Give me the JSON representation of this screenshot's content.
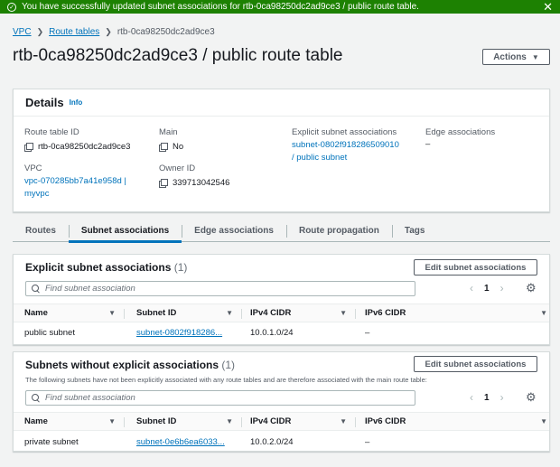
{
  "flash": {
    "message": "You have successfully updated subnet associations for rtb-0ca98250dc2ad9ce3 / public route table.",
    "success_icon": "check-circle-icon",
    "close_icon": "close-icon",
    "color": "#1d8102"
  },
  "breadcrumb": {
    "items": [
      "VPC",
      "Route tables",
      "rtb-0ca98250dc2ad9ce3"
    ]
  },
  "page": {
    "title": "rtb-0ca98250dc2ad9ce3 / public route table",
    "actions_label": "Actions"
  },
  "details": {
    "title": "Details",
    "info": "Info",
    "route_table_id_label": "Route table ID",
    "route_table_id": "rtb-0ca98250dc2ad9ce3",
    "vpc_label": "VPC",
    "vpc_value_line1": "vpc-070285bb7a41e958d |",
    "vpc_value_line2": "myvpc",
    "main_label": "Main",
    "main_value": "No",
    "owner_label": "Owner ID",
    "owner_value": "339713042546",
    "explicit_label": "Explicit subnet associations",
    "explicit_value_line1": "subnet-0802f918286509010",
    "explicit_value_line2": "/ public subnet",
    "edge_label": "Edge associations",
    "edge_value": "–"
  },
  "tabs": [
    "Routes",
    "Subnet associations",
    "Edge associations",
    "Route propagation",
    "Tags"
  ],
  "explicit_section": {
    "title": "Explicit subnet associations",
    "count": "(1)",
    "edit_label": "Edit subnet associations",
    "search_placeholder": "Find subnet association",
    "page": "1",
    "columns": [
      "Name",
      "Subnet ID",
      "IPv4 CIDR",
      "IPv6 CIDR"
    ],
    "rows": [
      {
        "name": "public subnet",
        "subnet_id": "subnet-0802f918286...",
        "ipv4": "10.0.1.0/24",
        "ipv6": "–"
      }
    ]
  },
  "without_section": {
    "title": "Subnets without explicit associations",
    "count": "(1)",
    "description": "The following subnets have not been explicitly associated with any route tables and are therefore associated with the main route table:",
    "edit_label": "Edit subnet associations",
    "search_placeholder": "Find subnet association",
    "page": "1",
    "columns": [
      "Name",
      "Subnet ID",
      "IPv4 CIDR",
      "IPv6 CIDR"
    ],
    "rows": [
      {
        "name": "private subnet",
        "subnet_id": "subnet-0e6b6ea6033...",
        "ipv4": "10.0.2.0/24",
        "ipv6": "–"
      }
    ]
  },
  "colors": {
    "link": "#0073bb",
    "text": "#16191f",
    "muted": "#545b64"
  }
}
